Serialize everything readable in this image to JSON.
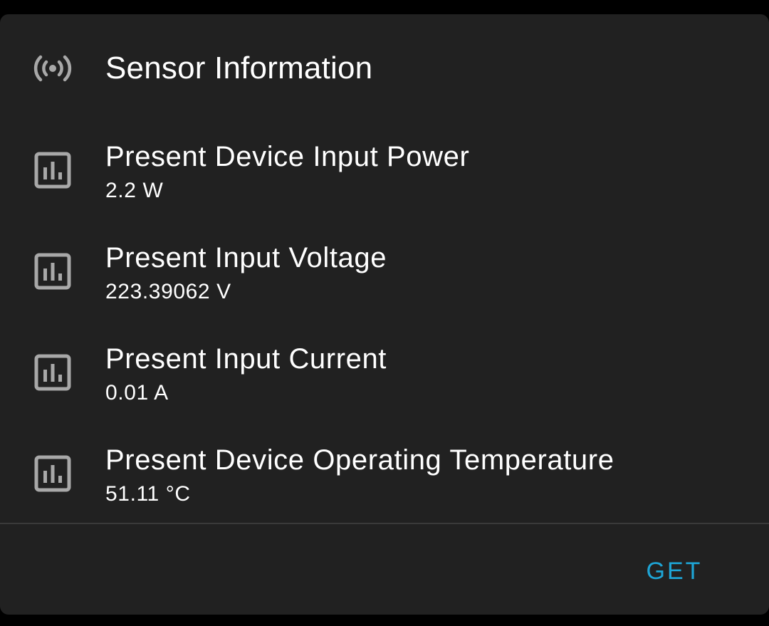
{
  "dialog": {
    "title": "Sensor Information",
    "header_icon": "broadcast-sensor-icon"
  },
  "sensors": [
    {
      "title": "Present Device Input Power",
      "value": "2.2 W",
      "icon": "bar-chart-icon"
    },
    {
      "title": "Present Input Voltage",
      "value": "223.39062 V",
      "icon": "bar-chart-icon"
    },
    {
      "title": "Present Input Current",
      "value": "0.01 A",
      "icon": "bar-chart-icon"
    },
    {
      "title": "Present Device Operating Temperature",
      "value": "51.11 °C",
      "icon": "bar-chart-icon"
    }
  ],
  "actions": {
    "get_label": "GET"
  },
  "colors": {
    "background": "#000000",
    "card": "#212121",
    "text": "#ffffff",
    "icon": "#a8a8a8",
    "accent": "#1ea5d6",
    "divider": "#3a3a3a"
  }
}
